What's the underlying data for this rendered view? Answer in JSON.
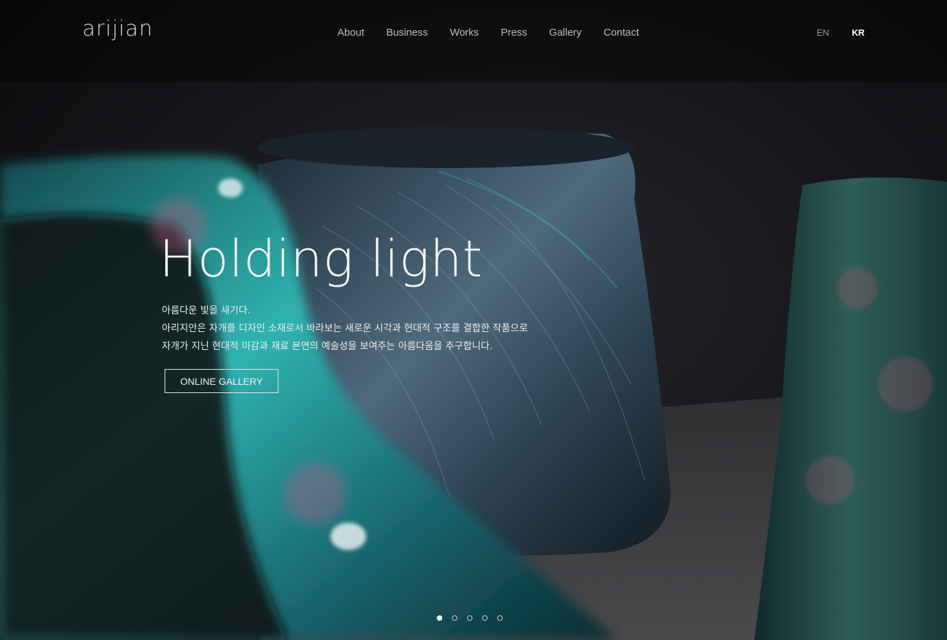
{
  "brand": {
    "logo": "arijian"
  },
  "nav": {
    "items": [
      "About",
      "Business",
      "Works",
      "Press",
      "Gallery",
      "Contact"
    ]
  },
  "lang": {
    "items": [
      "EN",
      "KR"
    ],
    "active": "KR"
  },
  "hero": {
    "headline": "Holding light",
    "lines": [
      "아름다운 빛을 새기다.",
      "아리지안은 자개를 디자인 소재로서 바라보는 새로운 시각과 현대적 구조를 결합한 작품으로",
      "자개가 지닌 현대적 미감과 재료 본연의 예술성을 보여주는 아름다움을 추구합니다."
    ],
    "cta_label": "ONLINE GALLERY"
  },
  "slider": {
    "count": 5,
    "active_index": 0
  },
  "colors": {
    "background": "#0d0d0f",
    "teal": "#2fb3b0",
    "slate": "#3a4a5c"
  }
}
